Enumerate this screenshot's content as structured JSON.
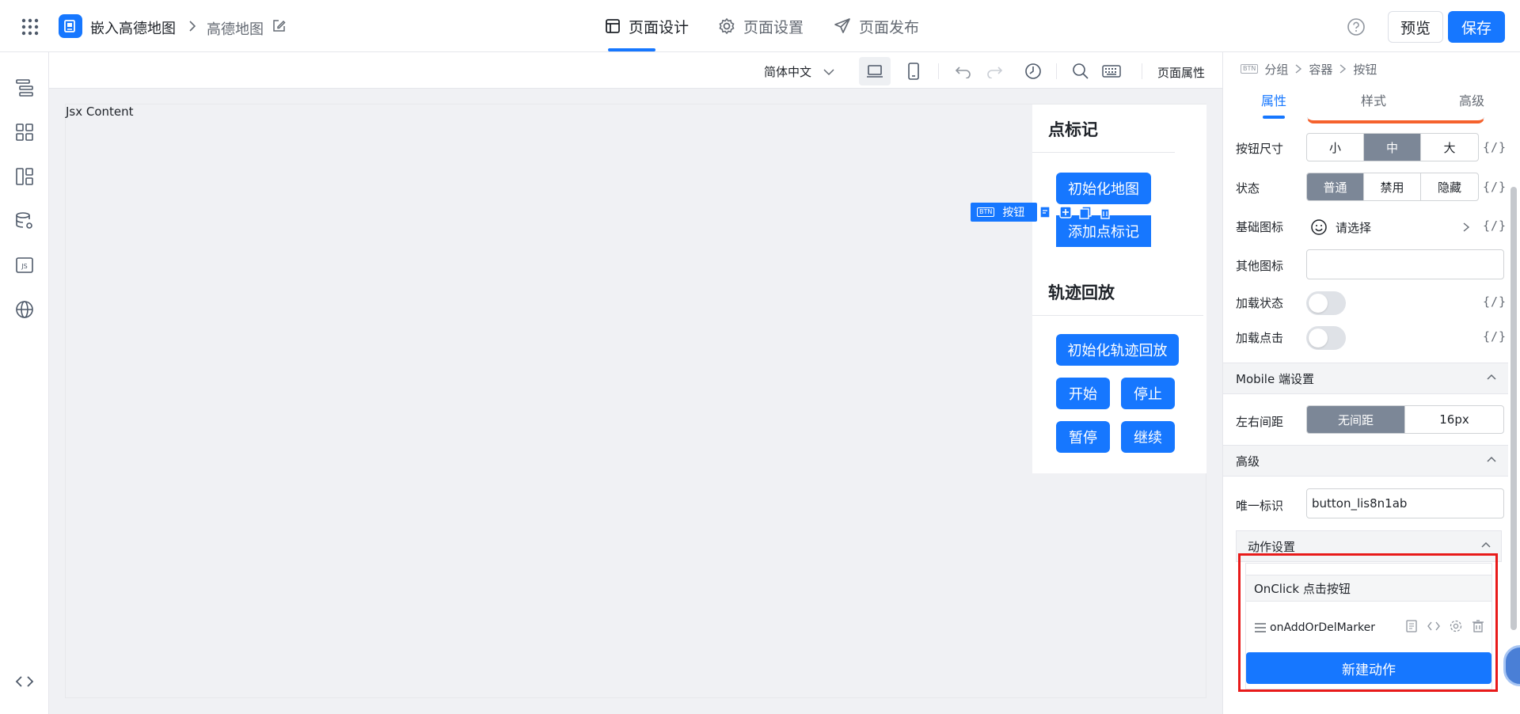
{
  "header": {
    "app_name": "嵌入高德地图",
    "page_name": "高德地图",
    "tabs": [
      {
        "label": "页面设计",
        "icon": "browser-window-icon",
        "active": true
      },
      {
        "label": "页面设置",
        "icon": "gear-icon",
        "active": false
      },
      {
        "label": "页面发布",
        "icon": "send-icon",
        "active": false
      }
    ],
    "preview_label": "预览",
    "save_label": "保存"
  },
  "leftbar": {
    "items": [
      {
        "name": "outline-tree-icon"
      },
      {
        "name": "components-grid-icon"
      },
      {
        "name": "layout-icon"
      },
      {
        "name": "datasource-icon"
      },
      {
        "name": "js-icon"
      },
      {
        "name": "globe-icon"
      }
    ],
    "bottom": "code-icon"
  },
  "canvas": {
    "language": "简体中文",
    "page_attr_label": "页面属性",
    "jsx_label": "Jsx Content",
    "selection_tag": "按钮",
    "selection_tag_mini": "BTN",
    "panel": {
      "section1_title": "点标记",
      "section1_buttons": [
        "初始化地图",
        "添加点标记"
      ],
      "section2_title": "轨迹回放",
      "section2_buttons": [
        "初始化轨迹回放",
        "开始",
        "停止",
        "暂停",
        "继续"
      ]
    }
  },
  "props": {
    "breadcrumb": [
      "分组",
      "容器",
      "按钮"
    ],
    "breadcrumb_mini": "BTN",
    "tabs": [
      "属性",
      "样式",
      "高级"
    ],
    "size_label": "按钮尺寸",
    "size_options": [
      "小",
      "中",
      "大"
    ],
    "size_selected": "中",
    "state_label": "状态",
    "state_options": [
      "普通",
      "禁用",
      "隐藏"
    ],
    "state_selected": "普通",
    "icon_label": "基础图标",
    "icon_placeholder": "请选择",
    "other_icon_label": "其他图标",
    "other_icon_value": "",
    "loading_label": "加载状态",
    "loading_click_label": "加载点击",
    "var_label": "{/}",
    "mobile_section": "Mobile 端设置",
    "padding_label": "左右间距",
    "padding_options": [
      "无间距",
      "16px"
    ],
    "padding_selected": "无间距",
    "advanced_section": "高级",
    "uid_label": "唯一标识",
    "uid_value": "button_lis8n1ab",
    "action_section": "动作设置",
    "event_title": "OnClick 点击按钮",
    "action_name": "onAddOrDelMarker",
    "new_action_label": "新建动作"
  },
  "colors": {
    "primary": "#1677ff",
    "segment_active": "#7c8797",
    "highlight_box": "#e81a1a",
    "accent_strip": "#f5622d"
  }
}
